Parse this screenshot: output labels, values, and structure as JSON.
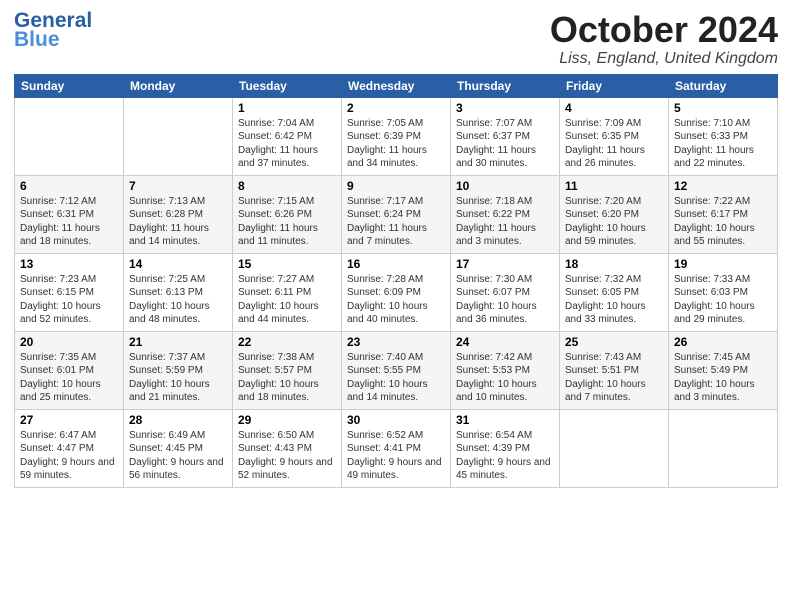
{
  "logo": {
    "line1": "General",
    "line2": "Blue"
  },
  "header": {
    "month": "October 2024",
    "location": "Liss, England, United Kingdom"
  },
  "weekdays": [
    "Sunday",
    "Monday",
    "Tuesday",
    "Wednesday",
    "Thursday",
    "Friday",
    "Saturday"
  ],
  "weeks": [
    [
      {
        "day": "",
        "info": ""
      },
      {
        "day": "",
        "info": ""
      },
      {
        "day": "1",
        "info": "Sunrise: 7:04 AM\nSunset: 6:42 PM\nDaylight: 11 hours and 37 minutes."
      },
      {
        "day": "2",
        "info": "Sunrise: 7:05 AM\nSunset: 6:39 PM\nDaylight: 11 hours and 34 minutes."
      },
      {
        "day": "3",
        "info": "Sunrise: 7:07 AM\nSunset: 6:37 PM\nDaylight: 11 hours and 30 minutes."
      },
      {
        "day": "4",
        "info": "Sunrise: 7:09 AM\nSunset: 6:35 PM\nDaylight: 11 hours and 26 minutes."
      },
      {
        "day": "5",
        "info": "Sunrise: 7:10 AM\nSunset: 6:33 PM\nDaylight: 11 hours and 22 minutes."
      }
    ],
    [
      {
        "day": "6",
        "info": "Sunrise: 7:12 AM\nSunset: 6:31 PM\nDaylight: 11 hours and 18 minutes."
      },
      {
        "day": "7",
        "info": "Sunrise: 7:13 AM\nSunset: 6:28 PM\nDaylight: 11 hours and 14 minutes."
      },
      {
        "day": "8",
        "info": "Sunrise: 7:15 AM\nSunset: 6:26 PM\nDaylight: 11 hours and 11 minutes."
      },
      {
        "day": "9",
        "info": "Sunrise: 7:17 AM\nSunset: 6:24 PM\nDaylight: 11 hours and 7 minutes."
      },
      {
        "day": "10",
        "info": "Sunrise: 7:18 AM\nSunset: 6:22 PM\nDaylight: 11 hours and 3 minutes."
      },
      {
        "day": "11",
        "info": "Sunrise: 7:20 AM\nSunset: 6:20 PM\nDaylight: 10 hours and 59 minutes."
      },
      {
        "day": "12",
        "info": "Sunrise: 7:22 AM\nSunset: 6:17 PM\nDaylight: 10 hours and 55 minutes."
      }
    ],
    [
      {
        "day": "13",
        "info": "Sunrise: 7:23 AM\nSunset: 6:15 PM\nDaylight: 10 hours and 52 minutes."
      },
      {
        "day": "14",
        "info": "Sunrise: 7:25 AM\nSunset: 6:13 PM\nDaylight: 10 hours and 48 minutes."
      },
      {
        "day": "15",
        "info": "Sunrise: 7:27 AM\nSunset: 6:11 PM\nDaylight: 10 hours and 44 minutes."
      },
      {
        "day": "16",
        "info": "Sunrise: 7:28 AM\nSunset: 6:09 PM\nDaylight: 10 hours and 40 minutes."
      },
      {
        "day": "17",
        "info": "Sunrise: 7:30 AM\nSunset: 6:07 PM\nDaylight: 10 hours and 36 minutes."
      },
      {
        "day": "18",
        "info": "Sunrise: 7:32 AM\nSunset: 6:05 PM\nDaylight: 10 hours and 33 minutes."
      },
      {
        "day": "19",
        "info": "Sunrise: 7:33 AM\nSunset: 6:03 PM\nDaylight: 10 hours and 29 minutes."
      }
    ],
    [
      {
        "day": "20",
        "info": "Sunrise: 7:35 AM\nSunset: 6:01 PM\nDaylight: 10 hours and 25 minutes."
      },
      {
        "day": "21",
        "info": "Sunrise: 7:37 AM\nSunset: 5:59 PM\nDaylight: 10 hours and 21 minutes."
      },
      {
        "day": "22",
        "info": "Sunrise: 7:38 AM\nSunset: 5:57 PM\nDaylight: 10 hours and 18 minutes."
      },
      {
        "day": "23",
        "info": "Sunrise: 7:40 AM\nSunset: 5:55 PM\nDaylight: 10 hours and 14 minutes."
      },
      {
        "day": "24",
        "info": "Sunrise: 7:42 AM\nSunset: 5:53 PM\nDaylight: 10 hours and 10 minutes."
      },
      {
        "day": "25",
        "info": "Sunrise: 7:43 AM\nSunset: 5:51 PM\nDaylight: 10 hours and 7 minutes."
      },
      {
        "day": "26",
        "info": "Sunrise: 7:45 AM\nSunset: 5:49 PM\nDaylight: 10 hours and 3 minutes."
      }
    ],
    [
      {
        "day": "27",
        "info": "Sunrise: 6:47 AM\nSunset: 4:47 PM\nDaylight: 9 hours and 59 minutes."
      },
      {
        "day": "28",
        "info": "Sunrise: 6:49 AM\nSunset: 4:45 PM\nDaylight: 9 hours and 56 minutes."
      },
      {
        "day": "29",
        "info": "Sunrise: 6:50 AM\nSunset: 4:43 PM\nDaylight: 9 hours and 52 minutes."
      },
      {
        "day": "30",
        "info": "Sunrise: 6:52 AM\nSunset: 4:41 PM\nDaylight: 9 hours and 49 minutes."
      },
      {
        "day": "31",
        "info": "Sunrise: 6:54 AM\nSunset: 4:39 PM\nDaylight: 9 hours and 45 minutes."
      },
      {
        "day": "",
        "info": ""
      },
      {
        "day": "",
        "info": ""
      }
    ]
  ]
}
